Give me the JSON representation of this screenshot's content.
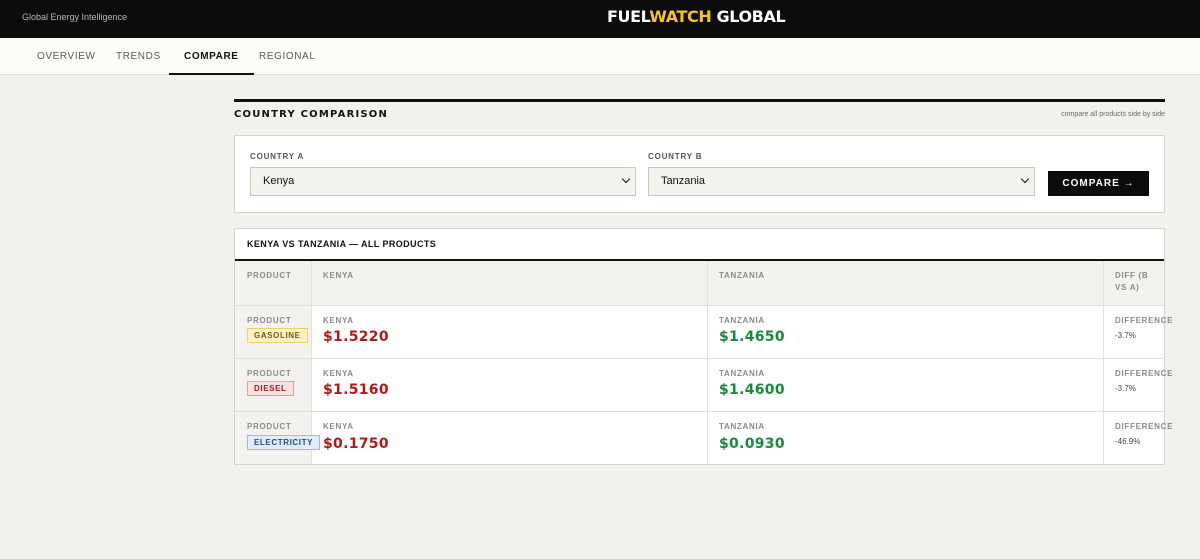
{
  "header": {
    "tagline": "Global Energy Intelligence",
    "logo_part1": "FUEL",
    "logo_part2": "WATCH",
    "logo_part3": " GLOBAL",
    "accent_color": "#f2c523"
  },
  "nav": {
    "tabs": [
      {
        "label": "OVERVIEW",
        "active": false
      },
      {
        "label": "TRENDS",
        "active": false
      },
      {
        "label": "COMPARE",
        "active": true
      },
      {
        "label": "REGIONAL",
        "active": false
      }
    ]
  },
  "section": {
    "title": "COUNTRY COMPARISON",
    "subtitle": "compare all products side by side"
  },
  "selector": {
    "country_a_label": "COUNTRY A",
    "country_a_value": "Kenya",
    "country_b_label": "COUNTRY B",
    "country_b_value": "Tanzania",
    "compare_button": "COMPARE →"
  },
  "table": {
    "title": "KENYA VS TANZANIA — ALL PRODUCTS",
    "headers": {
      "product": "PRODUCT",
      "a": "KENYA",
      "b": "TANZANIA",
      "diff_line1": "DIFF (B",
      "diff_line2": "VS A)"
    },
    "rows": [
      {
        "product_label": "PRODUCT",
        "product": "GASOLINE",
        "a_label": "KENYA",
        "a_price": "$1.5220",
        "b_label": "TANZANIA",
        "b_price": "$1.4650",
        "diff_label": "DIFFERENCE",
        "diff": "-3.7%"
      },
      {
        "product_label": "PRODUCT",
        "product": "DIESEL",
        "a_label": "KENYA",
        "a_price": "$1.5160",
        "b_label": "TANZANIA",
        "b_price": "$1.4600",
        "diff_label": "DIFFERENCE",
        "diff": "-3.7%"
      },
      {
        "product_label": "PRODUCT",
        "product": "ELECTRICITY",
        "a_label": "KENYA",
        "a_price": "$0.1750",
        "b_label": "TANZANIA",
        "b_price": "$0.0930",
        "diff_label": "DIFFERENCE",
        "diff": "-46.9%"
      }
    ],
    "colors": {
      "higher": "#b31818",
      "lower": "#178a3b"
    }
  }
}
